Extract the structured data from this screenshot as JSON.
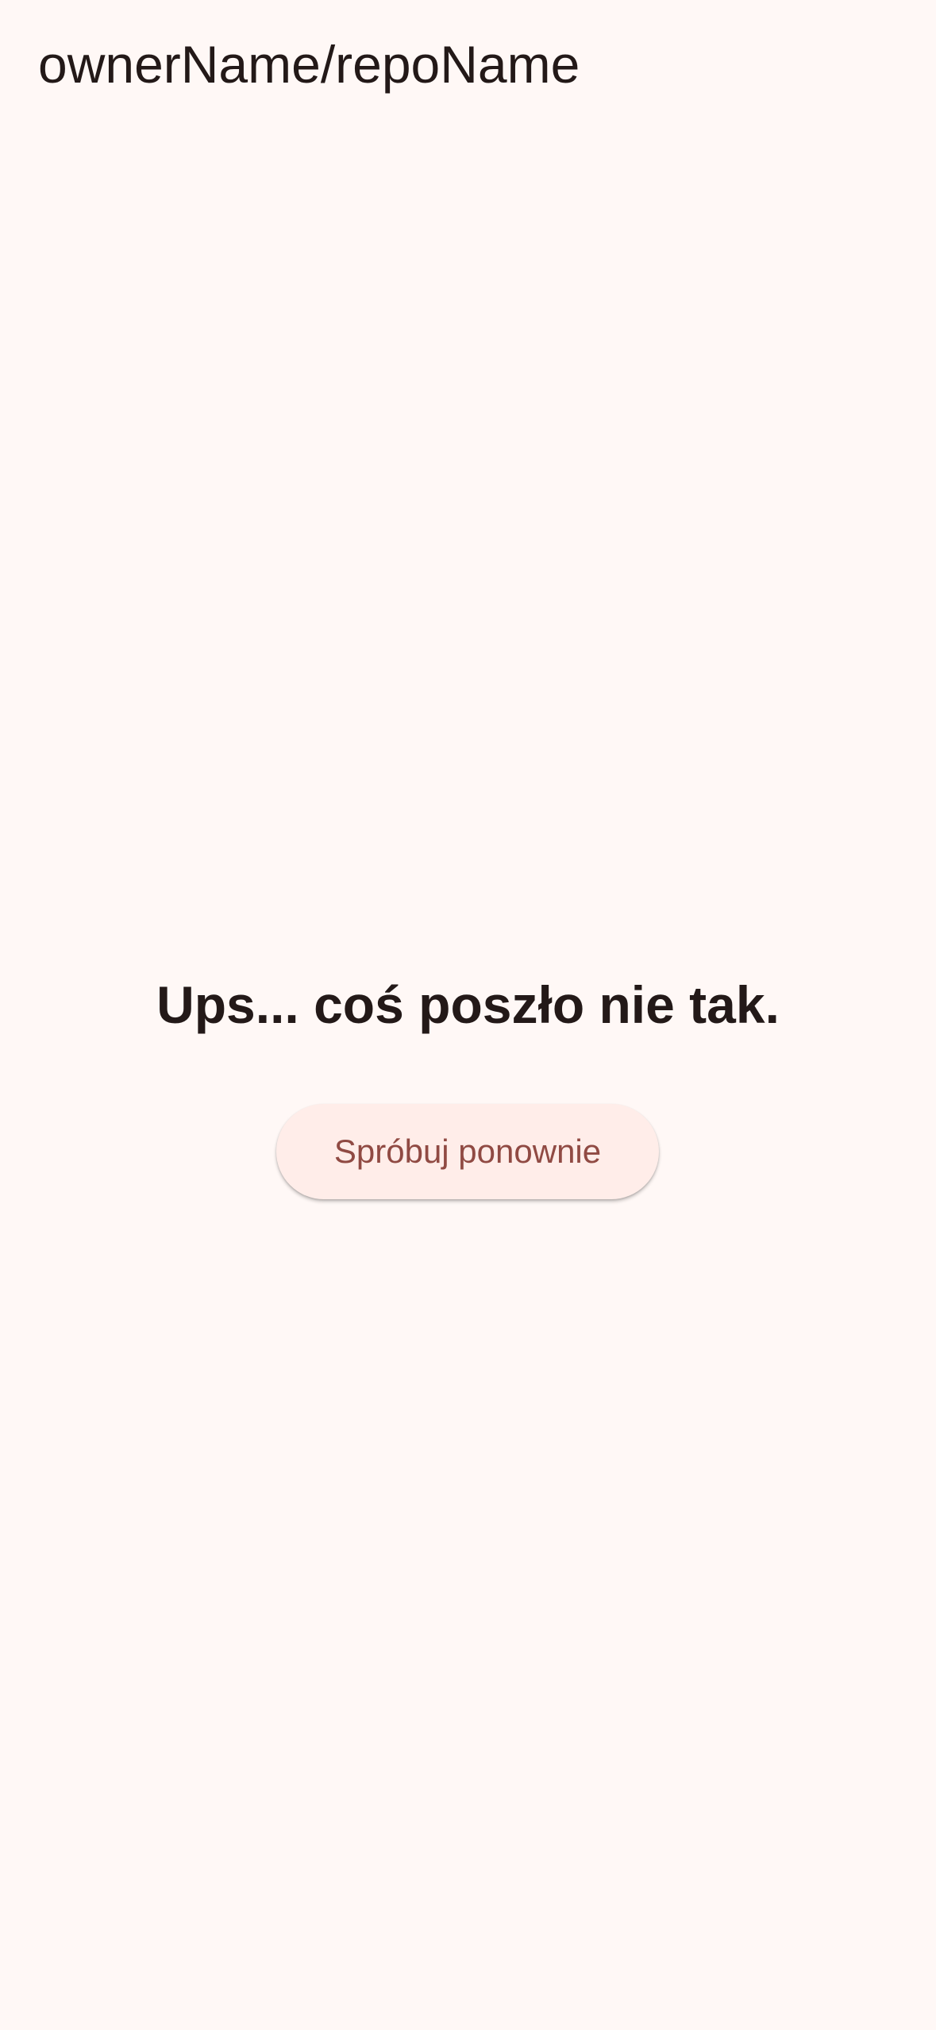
{
  "app_bar": {
    "title": "ownerName/repoName"
  },
  "error": {
    "message": "Ups... coś poszło nie tak.",
    "retry_label": "Spróbuj ponownie"
  },
  "colors": {
    "background": "#FFF8F6",
    "text": "#231918",
    "button_background": "#FFEDE9",
    "button_text": "#904A43"
  }
}
